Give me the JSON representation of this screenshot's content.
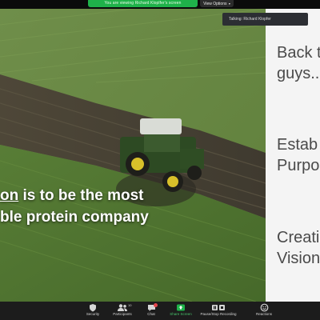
{
  "top_bar": {
    "viewing_text": "You are viewing Richard Kloplfer's screen",
    "view_options_label": "View Options"
  },
  "talking_indicator": {
    "text": "Talking: Richard Klopfer"
  },
  "slide": {
    "overlay_line1_underlined": "on",
    "overlay_line1_rest": " is to be the most",
    "overlay_line2": "ble protein company",
    "right_items": [
      "Back t",
      "guys..",
      "Estab",
      "Purpo",
      "Creati",
      "Vision"
    ]
  },
  "toolbar": {
    "items": [
      {
        "label": "Security",
        "icon": "shield-icon"
      },
      {
        "label": "Participants",
        "icon": "participants-icon",
        "count": "10"
      },
      {
        "label": "Chat",
        "icon": "chat-icon"
      },
      {
        "label": "Share Screen",
        "icon": "share-screen-icon"
      },
      {
        "label": "Pause/Stop Recording",
        "icon": "recording-icon"
      },
      {
        "label": "Reactions",
        "icon": "reactions-icon"
      }
    ]
  },
  "colors": {
    "share_green": "#1fb24a",
    "toolbar_bg": "#1c1c1c",
    "panel_bg": "#f4f4f4",
    "chat_badge": "#e5484d"
  }
}
